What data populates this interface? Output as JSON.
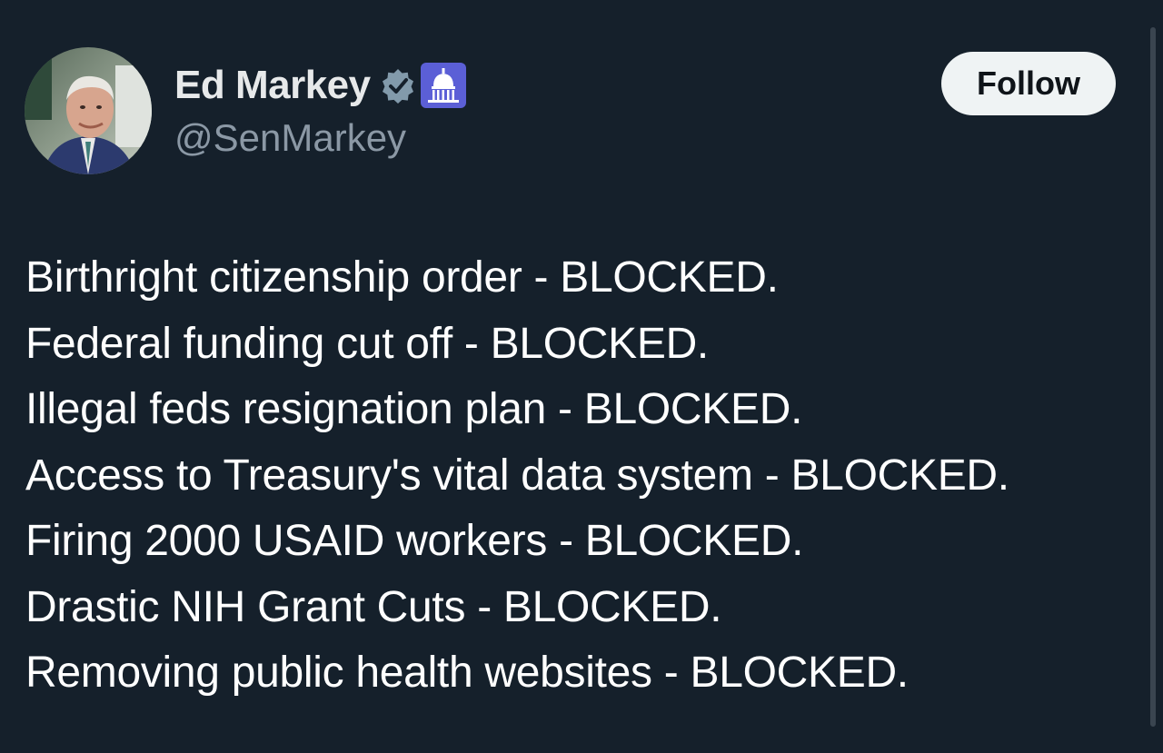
{
  "author": {
    "display_name": "Ed Markey",
    "handle": "@SenMarkey",
    "avatar_icon": "profile-photo",
    "verified_icon": "verified-badge-icon",
    "affiliation_icon": "us-capitol-government-icon"
  },
  "follow_button": {
    "label": "Follow"
  },
  "tweet": {
    "lines": [
      "Birthright citizenship order - BLOCKED.",
      "Federal funding cut off - BLOCKED.",
      "Illegal feds resignation plan - BLOCKED.",
      "Access to Treasury's vital data system - BLOCKED.",
      "Firing 2000 USAID workers - BLOCKED.",
      "Drastic NIH Grant Cuts - BLOCKED.",
      "Removing public health websites - BLOCKED."
    ]
  },
  "colors": {
    "background": "#15202b",
    "text_primary": "#e7e9ea",
    "text_secondary": "#8b98a5",
    "button_bg": "#eff3f4",
    "verified_badge": "#829aab",
    "gov_badge": "#5b5fd6"
  }
}
